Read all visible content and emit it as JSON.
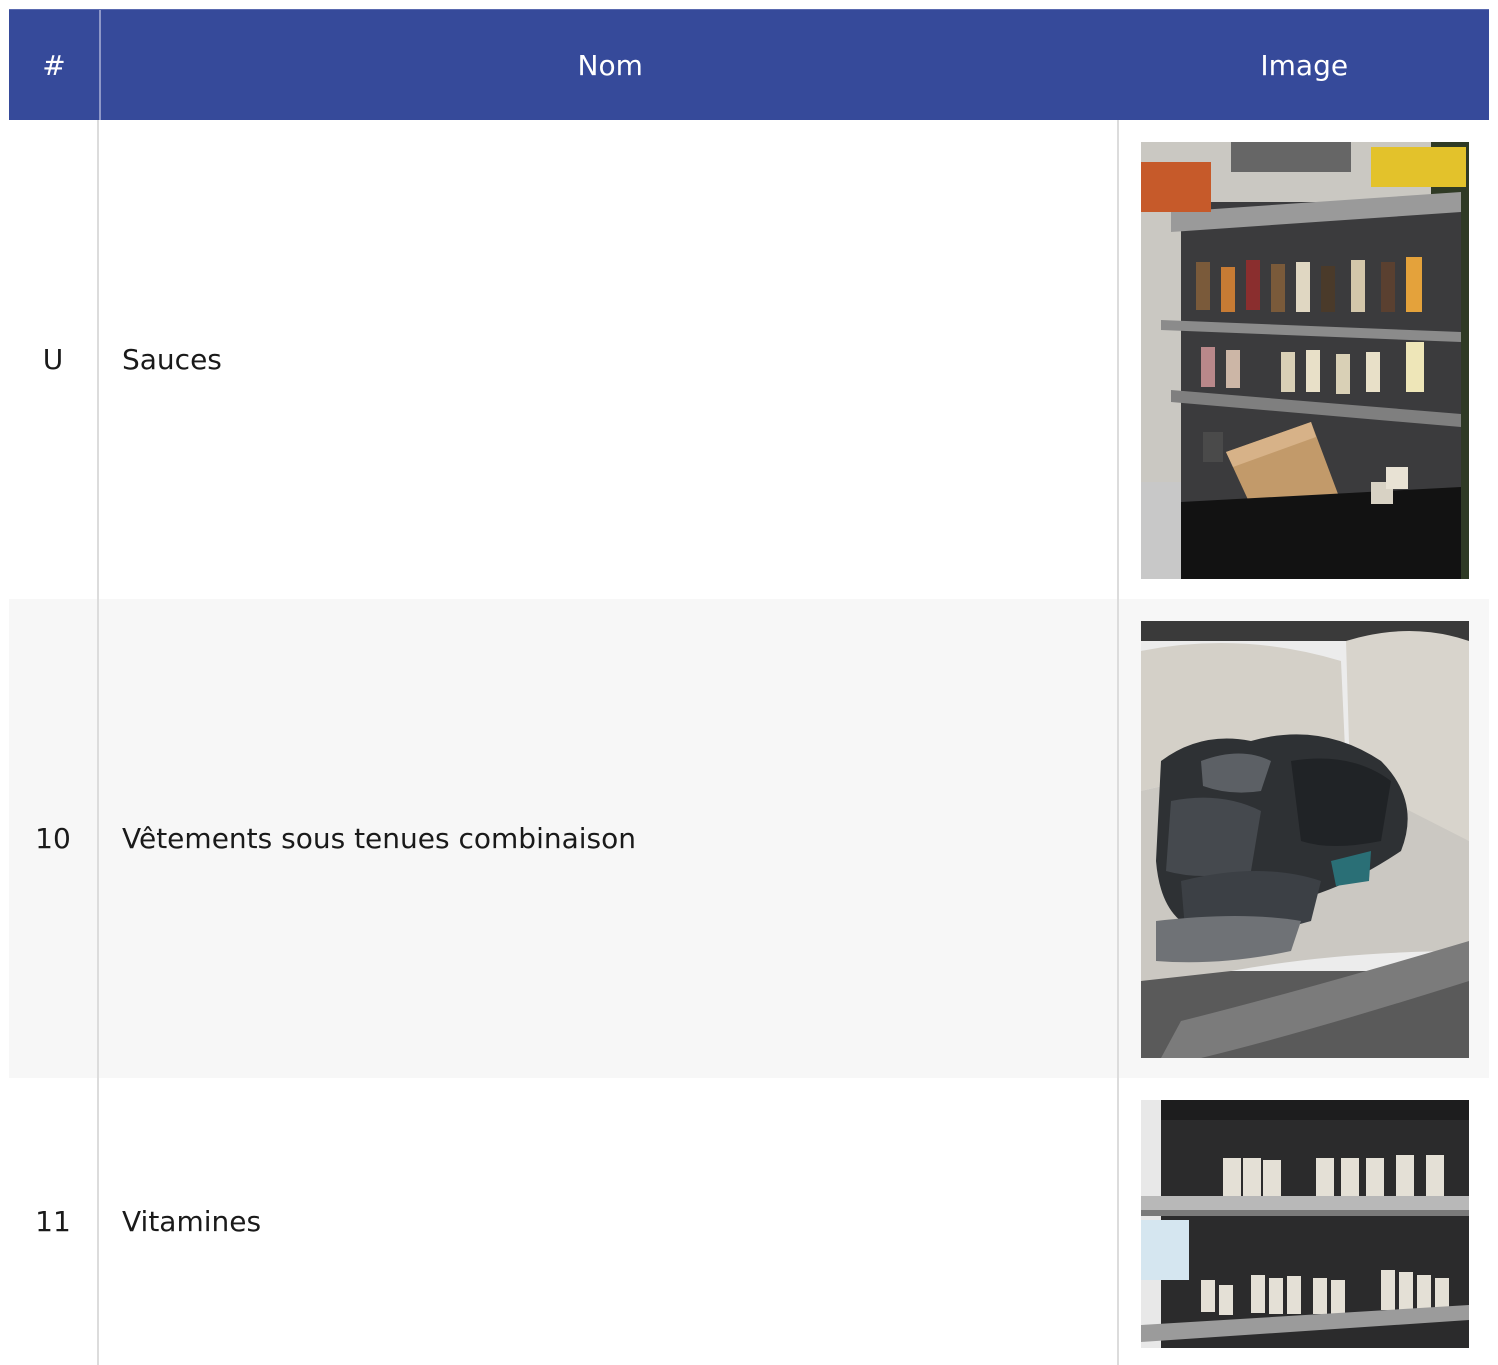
{
  "table": {
    "headers": {
      "num": "#",
      "name": "Nom",
      "image": "Image"
    },
    "rows": [
      {
        "num": "U",
        "name": "Sauces",
        "image_alt": "shelves-with-sauce-bottles"
      },
      {
        "num": "10",
        "name": "Vêtements sous tenues combinaison",
        "image_alt": "folded-clothes-on-sofa"
      },
      {
        "num": "11",
        "name": "Vitamines",
        "image_alt": "shelves-with-vitamin-bottles"
      }
    ]
  },
  "colors": {
    "header_bg": "#364a9a",
    "header_text": "#ffffff",
    "alt_row_bg": "#f7f7f7"
  }
}
